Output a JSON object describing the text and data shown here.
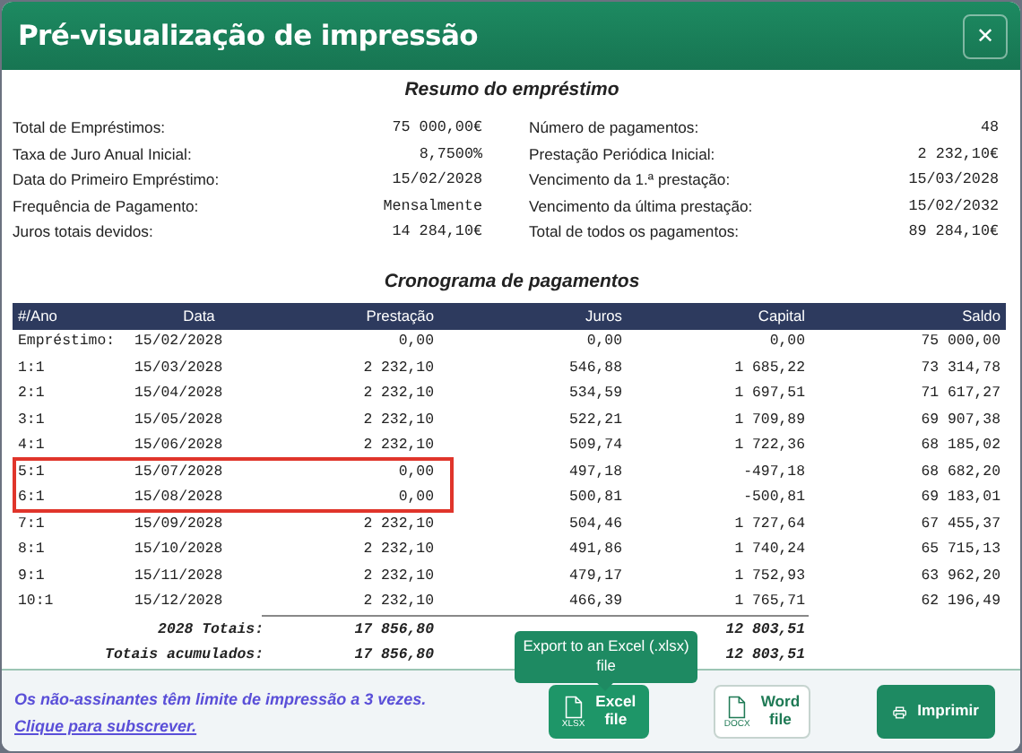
{
  "window": {
    "title": "Pré-visualização de impressão",
    "close": "✕"
  },
  "summary": {
    "title": "Resumo do empréstimo",
    "left": [
      {
        "label": "Total de Empréstimos:",
        "value": "75 000,00€"
      },
      {
        "label": "Taxa de Juro Anual Inicial:",
        "value": "8,7500%"
      },
      {
        "label": "Data do Primeiro Empréstimo:",
        "value": "15/02/2028"
      },
      {
        "label": "Frequência de Pagamento:",
        "value": "Mensalmente"
      },
      {
        "label": "Juros totais devidos:",
        "value": "14 284,10€"
      }
    ],
    "right": [
      {
        "label": "Número de pagamentos:",
        "value": "48"
      },
      {
        "label": "Prestação Periódica Inicial:",
        "value": "2 232,10€"
      },
      {
        "label": "Vencimento da 1.ª prestação:",
        "value": "15/03/2028"
      },
      {
        "label": "Vencimento da última prestação:",
        "value": "15/02/2032"
      },
      {
        "label": "Total de todos os pagamentos:",
        "value": "89 284,10€"
      }
    ]
  },
  "schedule": {
    "title": "Cronograma de pagamentos",
    "columns": [
      "#/Ano",
      "Data",
      "Prestação",
      "Juros",
      "Capital",
      "Saldo"
    ],
    "rows": [
      {
        "cells": [
          "Empréstimo:",
          "15/02/2028",
          "0,00",
          "0,00",
          "0,00",
          "75 000,00"
        ],
        "highlighted": false
      },
      {
        "cells": [
          "1:1",
          "15/03/2028",
          "2 232,10",
          "546,88",
          "1 685,22",
          "73 314,78"
        ],
        "highlighted": false
      },
      {
        "cells": [
          "2:1",
          "15/04/2028",
          "2 232,10",
          "534,59",
          "1 697,51",
          "71 617,27"
        ],
        "highlighted": false
      },
      {
        "cells": [
          "3:1",
          "15/05/2028",
          "2 232,10",
          "522,21",
          "1 709,89",
          "69 907,38"
        ],
        "highlighted": false
      },
      {
        "cells": [
          "4:1",
          "15/06/2028",
          "2 232,10",
          "509,74",
          "1 722,36",
          "68 185,02"
        ],
        "highlighted": false
      },
      {
        "cells": [
          "5:1",
          "15/07/2028",
          "0,00",
          "497,18",
          "-497,18",
          "68 682,20"
        ],
        "highlighted": true
      },
      {
        "cells": [
          "6:1",
          "15/08/2028",
          "0,00",
          "500,81",
          "-500,81",
          "69 183,01"
        ],
        "highlighted": true
      },
      {
        "cells": [
          "7:1",
          "15/09/2028",
          "2 232,10",
          "504,46",
          "1 727,64",
          "67 455,37"
        ],
        "highlighted": false
      },
      {
        "cells": [
          "8:1",
          "15/10/2028",
          "2 232,10",
          "491,86",
          "1 740,24",
          "65 715,13"
        ],
        "highlighted": false
      },
      {
        "cells": [
          "9:1",
          "15/11/2028",
          "2 232,10",
          "479,17",
          "1 752,93",
          "63 962,20"
        ],
        "highlighted": false
      },
      {
        "cells": [
          "10:1",
          "15/12/2028",
          "2 232,10",
          "466,39",
          "1 765,71",
          "62 196,49"
        ],
        "highlighted": false
      }
    ],
    "totals": [
      {
        "label": "2028 Totais:",
        "prestacao": "17 856,80",
        "capital": "12 803,51"
      },
      {
        "label": "Totais acumulados:",
        "prestacao": "17 856,80",
        "capital": "12 803,51"
      }
    ]
  },
  "footer": {
    "notice": "Os não-assinantes têm limite de impressão a 3 vezes.",
    "link": "Clique para subscrever.",
    "tooltip": "Export to an Excel (.xlsx) file",
    "buttons": [
      {
        "kind": "excel",
        "label": "Excel file",
        "icon_text": "XLSX"
      },
      {
        "kind": "word",
        "label": "Word file",
        "icon_text": "DOCX"
      },
      {
        "kind": "print",
        "label": "Imprimir"
      }
    ]
  }
}
